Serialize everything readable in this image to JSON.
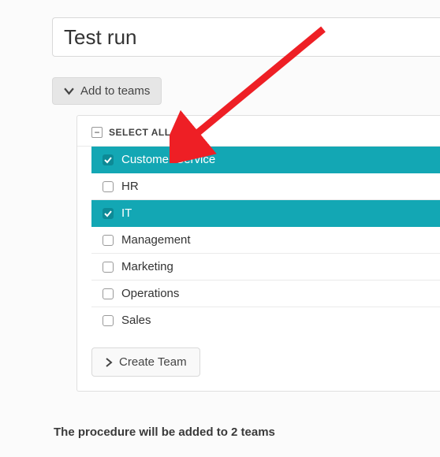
{
  "input": {
    "value": "Test run"
  },
  "buttons": {
    "add_to_teams": "Add to teams",
    "create_team": "Create Team"
  },
  "select_all_label": "SELECT ALL",
  "select_all_state": "partial",
  "teams": [
    {
      "label": "Customer Service",
      "selected": true
    },
    {
      "label": "HR",
      "selected": false
    },
    {
      "label": "IT",
      "selected": true
    },
    {
      "label": "Management",
      "selected": false
    },
    {
      "label": "Marketing",
      "selected": false
    },
    {
      "label": "Operations",
      "selected": false
    },
    {
      "label": "Sales",
      "selected": false
    }
  ],
  "summary_text": "The procedure will be added to 2 teams",
  "colors": {
    "accent": "#13a7b4",
    "arrow": "#ee1f25"
  }
}
